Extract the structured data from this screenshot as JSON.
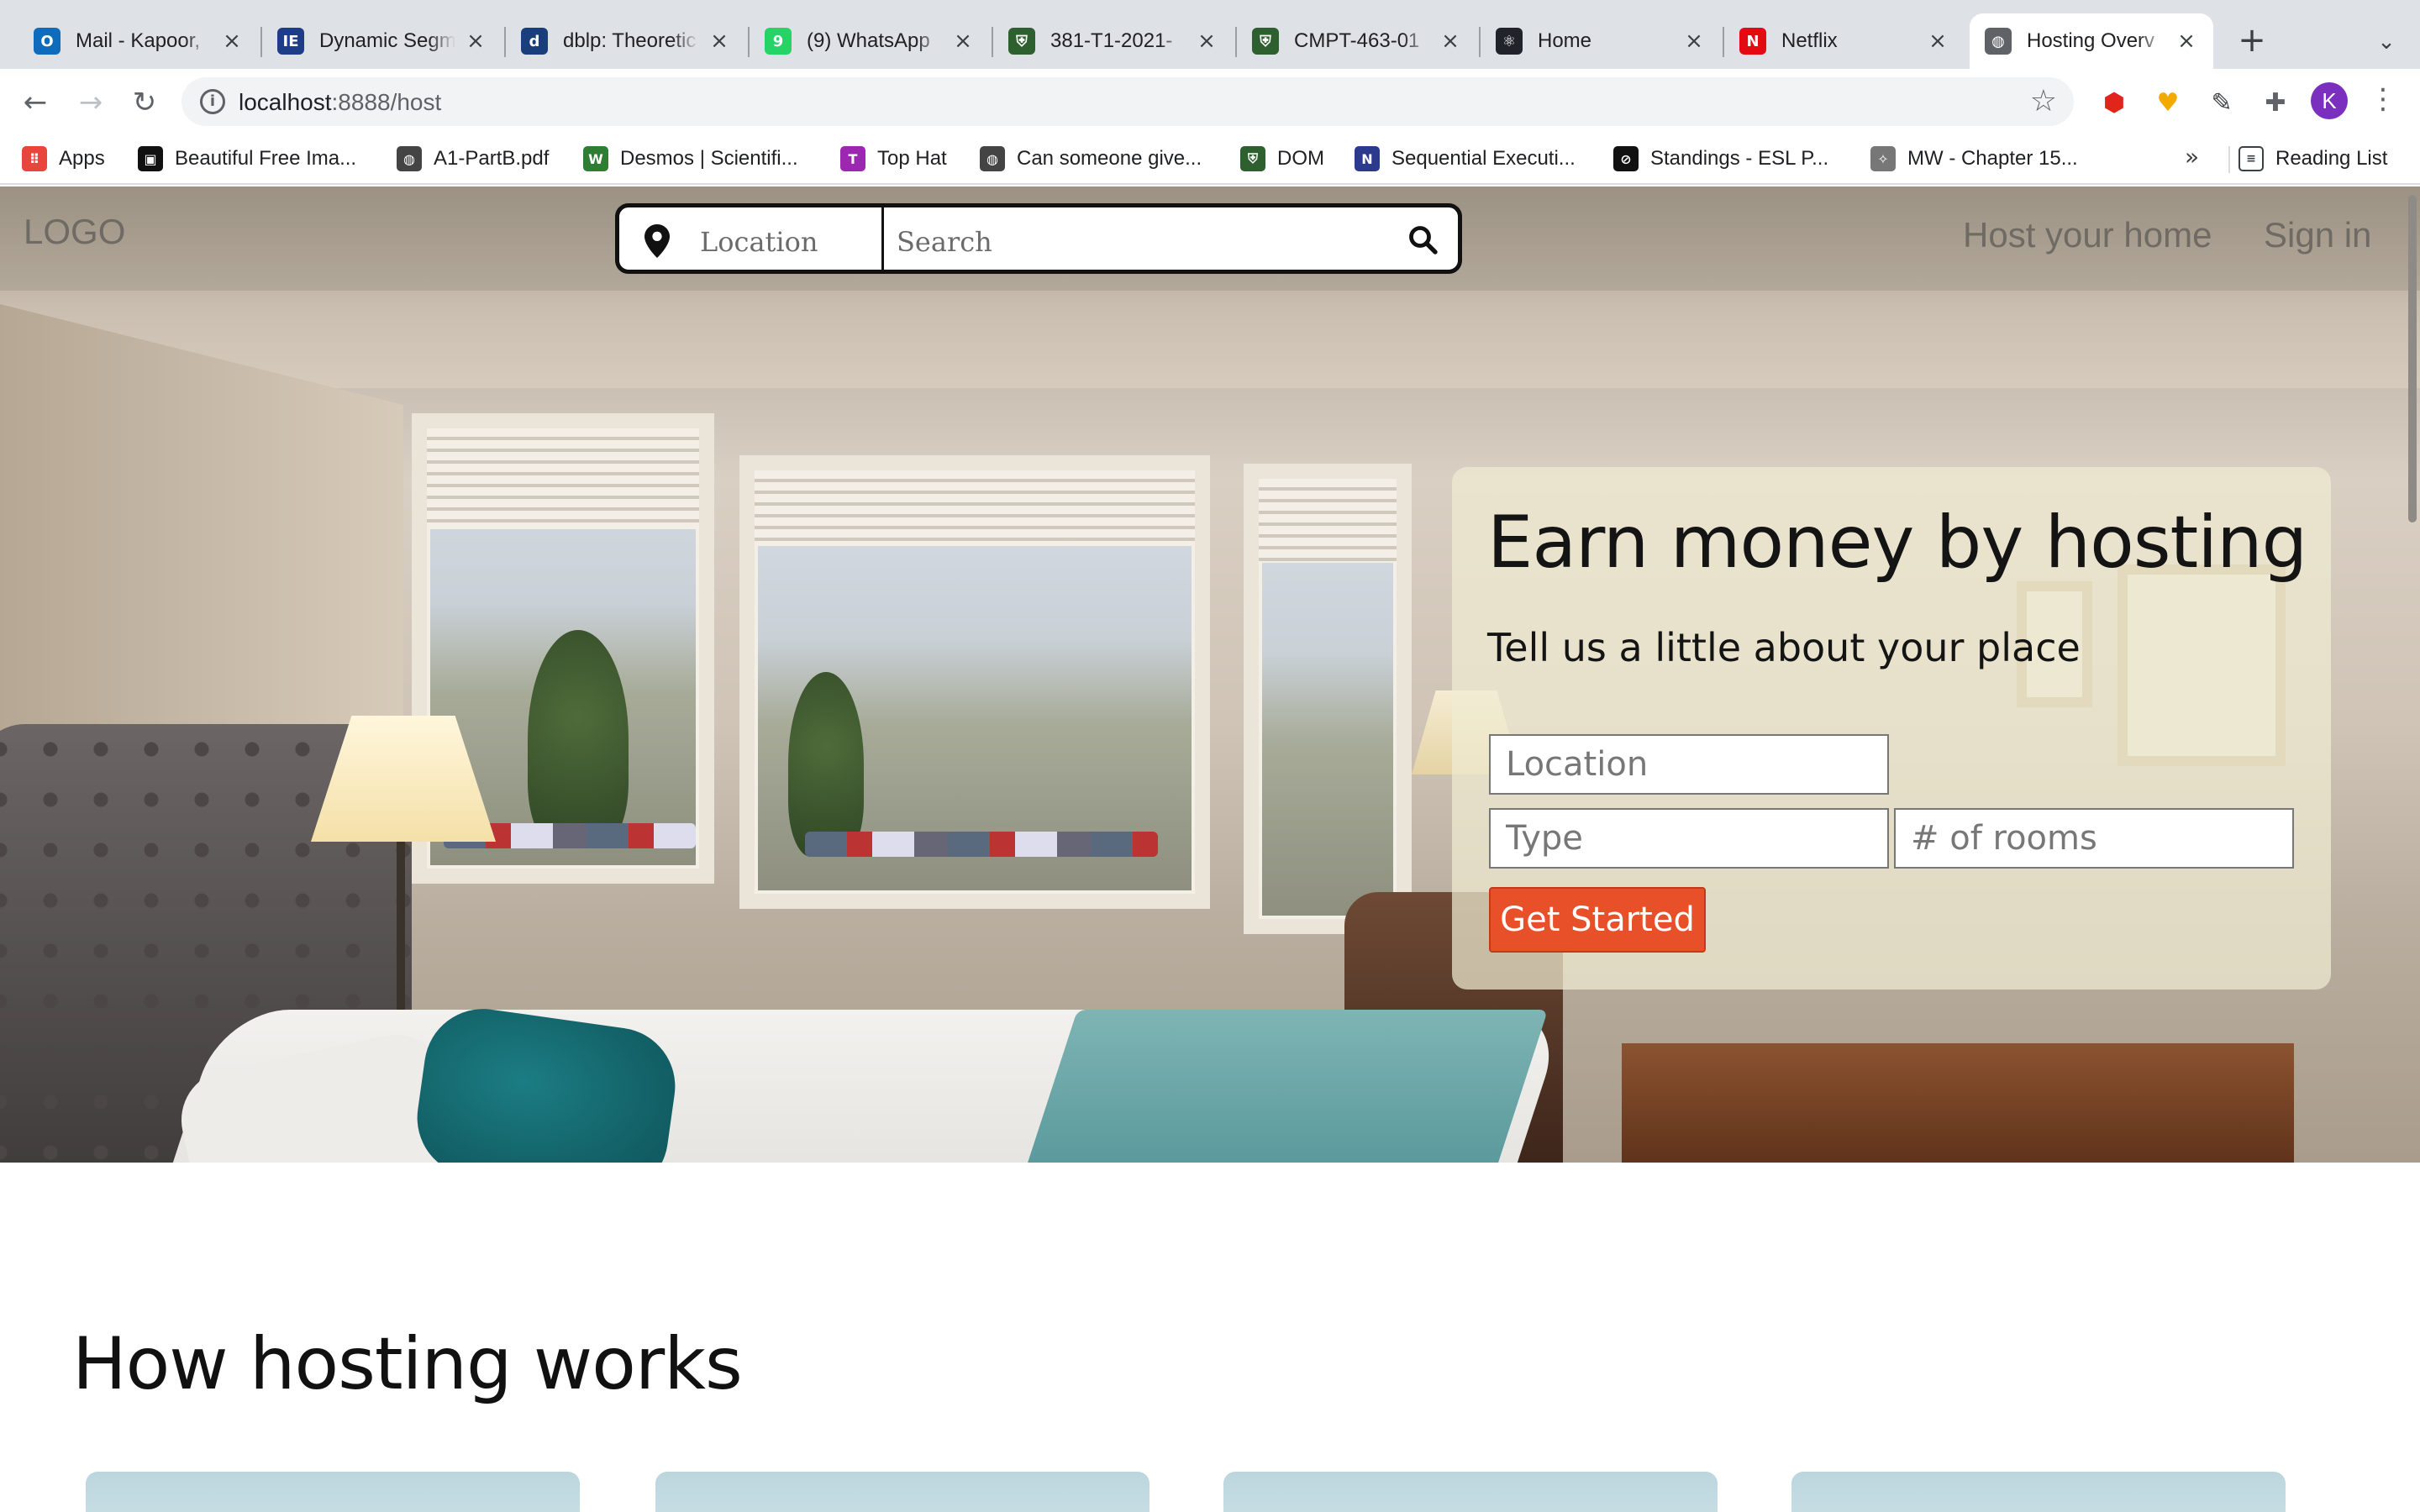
{
  "browser": {
    "tabs": [
      {
        "title": "Mail - Kapoor,",
        "favicon": "outlook-icon",
        "color": "#0f6cbd",
        "glyph": "O"
      },
      {
        "title": "Dynamic Segm",
        "favicon": "ieee-icon",
        "color": "#1f3c88",
        "glyph": "IE"
      },
      {
        "title": "dblp: Theoretic",
        "favicon": "dblp-icon",
        "color": "#1a3d7c",
        "glyph": "d"
      },
      {
        "title": "(9) WhatsApp",
        "favicon": "whatsapp-icon",
        "color": "#25d366",
        "glyph": "9"
      },
      {
        "title": "381-T1-2021-",
        "favicon": "shield-icon",
        "color": "#2e5f2e",
        "glyph": "⛨"
      },
      {
        "title": "CMPT-463-01",
        "favicon": "shield-icon",
        "color": "#2e5f2e",
        "glyph": "⛨"
      },
      {
        "title": "Home",
        "favicon": "react-icon",
        "color": "#20232a",
        "glyph": "⚛"
      },
      {
        "title": "Netflix",
        "favicon": "netflix-icon",
        "color": "#e50914",
        "glyph": "N"
      },
      {
        "title": "Hosting Overv",
        "favicon": "globe-icon",
        "color": "#5f6368",
        "glyph": "◍"
      }
    ],
    "active_tab_index": 8,
    "url_host": "localhost",
    "url_rest": ":8888/host",
    "bookmarks": [
      {
        "label": "Apps",
        "icon": "apps-grid-icon",
        "color": "#e8453c",
        "glyph": "⠿"
      },
      {
        "label": "Beautiful Free Ima...",
        "icon": "unsplash-icon",
        "color": "#111111",
        "glyph": "▣"
      },
      {
        "label": "A1-PartB.pdf",
        "icon": "globe-icon",
        "color": "#444444",
        "glyph": "◍"
      },
      {
        "label": "Desmos | Scientifi...",
        "icon": "desmos-icon",
        "color": "#2f7d32",
        "glyph": "W"
      },
      {
        "label": "Top Hat",
        "icon": "tophat-icon",
        "color": "#9c27b0",
        "glyph": "T"
      },
      {
        "label": "Can someone give...",
        "icon": "globe-icon",
        "color": "#444444",
        "glyph": "◍"
      },
      {
        "label": "DOM",
        "icon": "shield-icon",
        "color": "#2e5f2e",
        "glyph": "⛨"
      },
      {
        "label": "Sequential Executi...",
        "icon": "next-icon",
        "color": "#2b3a8c",
        "glyph": "N"
      },
      {
        "label": "Standings - ESL P...",
        "icon": "esl-icon",
        "color": "#111111",
        "glyph": "⊘"
      },
      {
        "label": "MW - Chapter 15...",
        "icon": "mw-icon",
        "color": "#777777",
        "glyph": "✧"
      }
    ],
    "reading_list_label": "Reading List",
    "profile_initial": "K"
  },
  "site": {
    "logo": "LOGO",
    "search": {
      "location_placeholder": "Location",
      "search_placeholder": "Search"
    },
    "nav": {
      "host_label": "Host your home",
      "signin_label": "Sign in"
    },
    "hero_card": {
      "title": "Earn money by hosting",
      "subtitle": "Tell us a little about your place",
      "location_placeholder": "Location",
      "type_placeholder": "Type",
      "rooms_placeholder": "# of rooms",
      "cta_label": "Get Started"
    },
    "how_title": "How hosting works",
    "accent_color": "#e8502a"
  }
}
